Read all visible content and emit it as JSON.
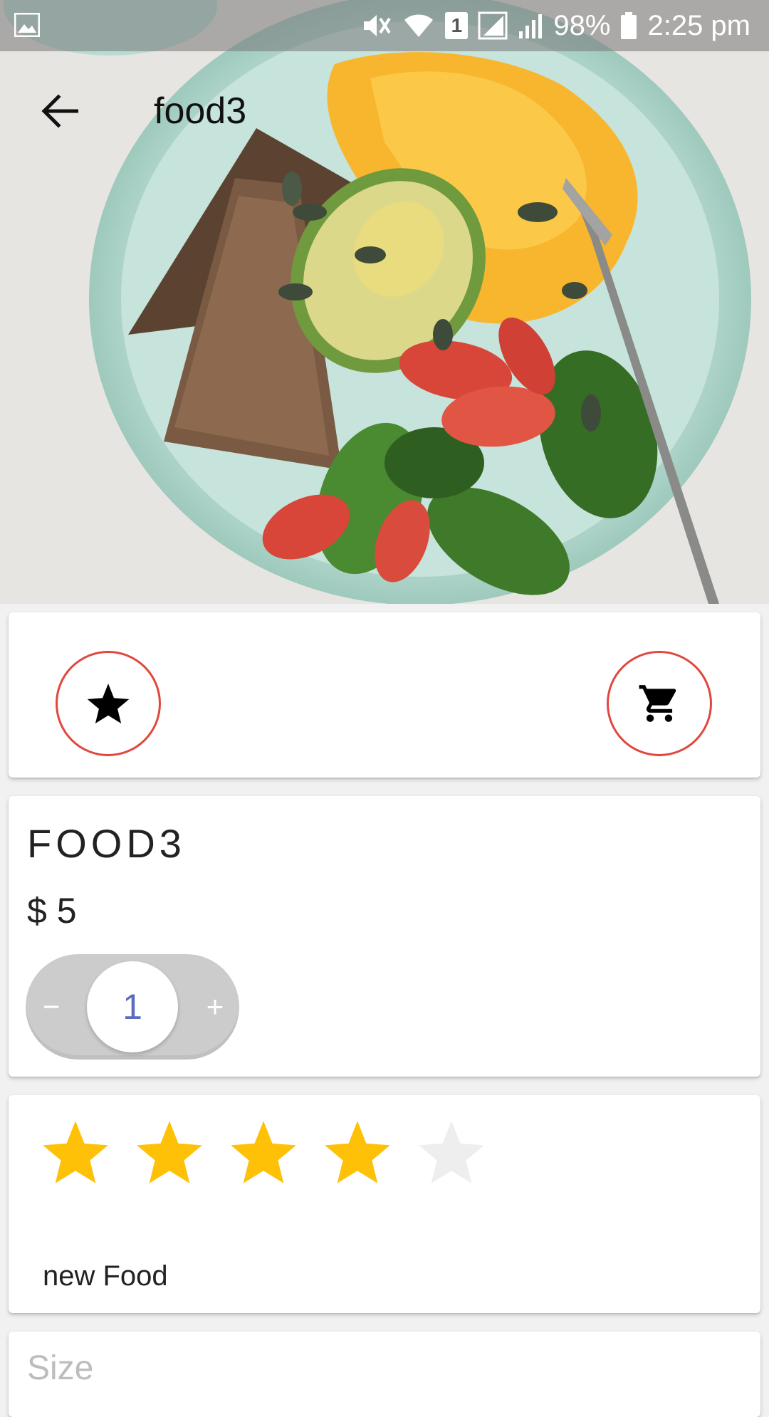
{
  "status_bar": {
    "battery": "98%",
    "time": "2:25 pm",
    "sim_badge": "1"
  },
  "app_bar": {
    "title": "food3",
    "back_icon": "arrow-back-icon"
  },
  "actions": {
    "favorite_icon": "star-icon",
    "cart_icon": "shopping-cart-icon",
    "border_color": "#e0473d"
  },
  "food": {
    "name": "FOOD3",
    "price": "$ 5",
    "quantity": "1",
    "minus_label": "−",
    "plus_label": "+"
  },
  "rating": {
    "value": 4,
    "max": 5,
    "filled_color": "#fec107",
    "empty_color": "#eeeeee",
    "description": "new Food"
  },
  "size": {
    "label": "Size"
  }
}
